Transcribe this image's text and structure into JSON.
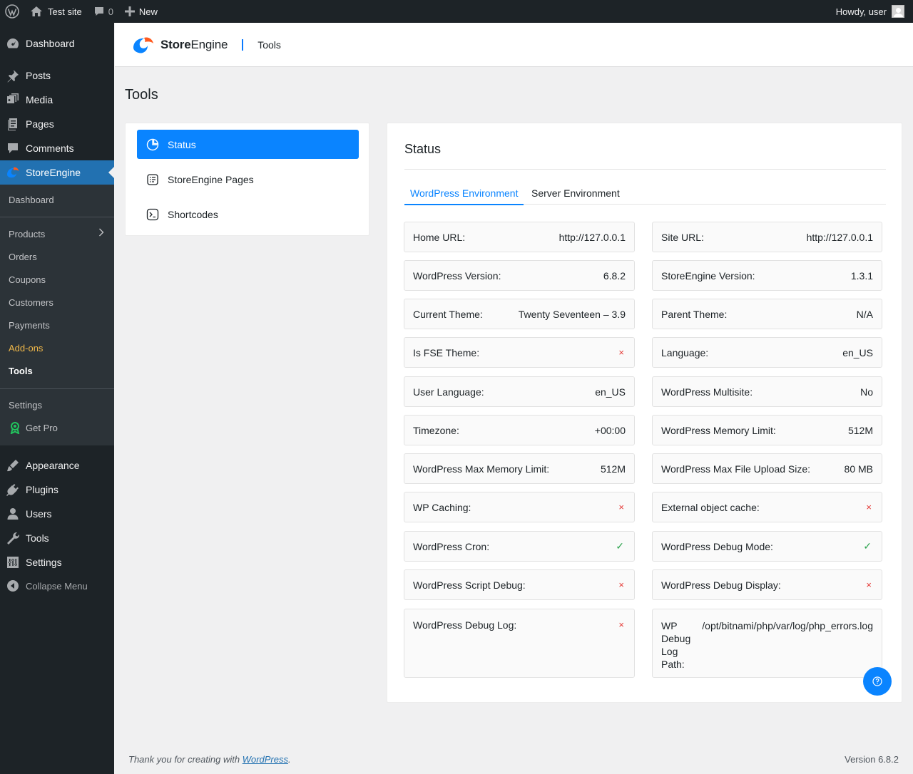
{
  "adminbar": {
    "site_name": "Test site",
    "comments_count": "0",
    "new_label": "New",
    "howdy": "Howdy, user"
  },
  "sidebar": {
    "items_top": [
      {
        "label": "Dashboard",
        "icon": "dashboard-icon"
      },
      {
        "label": "Posts",
        "icon": "pin-icon"
      },
      {
        "label": "Media",
        "icon": "media-icon"
      },
      {
        "label": "Pages",
        "icon": "pages-icon"
      },
      {
        "label": "Comments",
        "icon": "comment-icon"
      },
      {
        "label": "StoreEngine",
        "icon": "storeengine-icon"
      }
    ],
    "submenu": [
      "Dashboard",
      "Products",
      "Orders",
      "Coupons",
      "Customers",
      "Payments",
      "Add-ons",
      "Tools",
      "Settings",
      "Get Pro"
    ],
    "items_bottom": [
      {
        "label": "Appearance",
        "icon": "brush-icon"
      },
      {
        "label": "Plugins",
        "icon": "plugin-icon"
      },
      {
        "label": "Users",
        "icon": "user-icon"
      },
      {
        "label": "Tools",
        "icon": "wrench-icon"
      },
      {
        "label": "Settings",
        "icon": "settings-icon"
      }
    ],
    "collapse_label": "Collapse Menu"
  },
  "header": {
    "logo_bold": "Store",
    "logo_rest": "Engine",
    "page": "Tools"
  },
  "page_title": "Tools",
  "nav": [
    {
      "label": "Status",
      "icon": "pie-chart-icon"
    },
    {
      "label": "StoreEngine Pages",
      "icon": "pages-list-icon"
    },
    {
      "label": "Shortcodes",
      "icon": "terminal-icon"
    }
  ],
  "status": {
    "title": "Status",
    "tabs": [
      "WordPress Environment",
      "Server Environment"
    ],
    "left": [
      {
        "label": "Home URL:",
        "value": "http://127.0.0.1"
      },
      {
        "label": "WordPress Version:",
        "value": "6.8.2"
      },
      {
        "label": "Current Theme:",
        "value": "Twenty Seventeen – 3.9"
      },
      {
        "label": "Is FSE Theme:",
        "value": "×"
      },
      {
        "label": "User Language:",
        "value": "en_US"
      },
      {
        "label": "Timezone:",
        "value": "+00:00"
      },
      {
        "label": "WordPress Max Memory Limit:",
        "value": "512M"
      },
      {
        "label": "WP Caching:",
        "value": "×"
      },
      {
        "label": "WordPress Cron:",
        "value": "✓"
      },
      {
        "label": "WordPress Script Debug:",
        "value": "×"
      },
      {
        "label": "WordPress Debug Log:",
        "value": "×"
      }
    ],
    "right": [
      {
        "label": "Site URL:",
        "value": "http://127.0.0.1"
      },
      {
        "label": "StoreEngine Version:",
        "value": "1.3.1"
      },
      {
        "label": "Parent Theme:",
        "value": "N/A"
      },
      {
        "label": "Language:",
        "value": "en_US"
      },
      {
        "label": "WordPress Multisite:",
        "value": "No"
      },
      {
        "label": "WordPress Memory Limit:",
        "value": "512M"
      },
      {
        "label": "WordPress Max File Upload Size:",
        "value": "80 MB"
      },
      {
        "label": "External object cache:",
        "value": "×"
      },
      {
        "label": "WordPress Debug Mode:",
        "value": "✓"
      },
      {
        "label": "WordPress Debug Display:",
        "value": "×"
      },
      {
        "label": "WP Debug Log Path:",
        "value": "/opt/bitnami/php/var/log/php_errors.log"
      }
    ]
  },
  "footer": {
    "thanks_prefix": "Thank you for creating with ",
    "thanks_link": "WordPress",
    "thanks_suffix": ".",
    "version": "Version 6.8.2"
  },
  "colors": {
    "accent": "#0a84ff",
    "wp_blue": "#2271b1",
    "admin_dark": "#1d2327",
    "error": "#e53935",
    "success": "#2ea44f"
  }
}
